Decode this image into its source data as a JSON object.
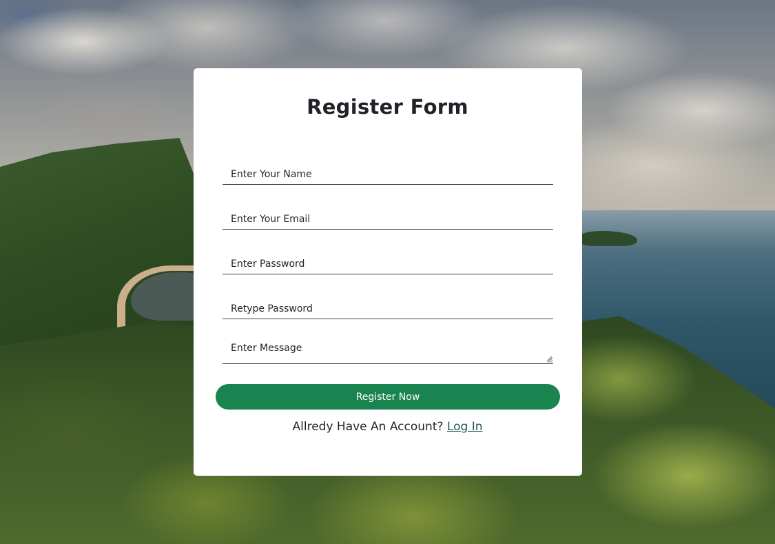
{
  "form": {
    "title": "Register Form",
    "fields": [
      {
        "placeholder": "Enter Your Name",
        "value": ""
      },
      {
        "placeholder": "Enter Your Email",
        "value": ""
      },
      {
        "placeholder": "Enter Password",
        "value": ""
      },
      {
        "placeholder": "Retype Password",
        "value": ""
      },
      {
        "placeholder": "Enter Message",
        "value": ""
      }
    ],
    "submit_label": "Register Now",
    "account_prompt": "Allredy Have An Account?",
    "login_label": "Log In"
  },
  "colors": {
    "button": "#1a8451",
    "underline": "#2f4a3e",
    "card": "#ffffff"
  }
}
